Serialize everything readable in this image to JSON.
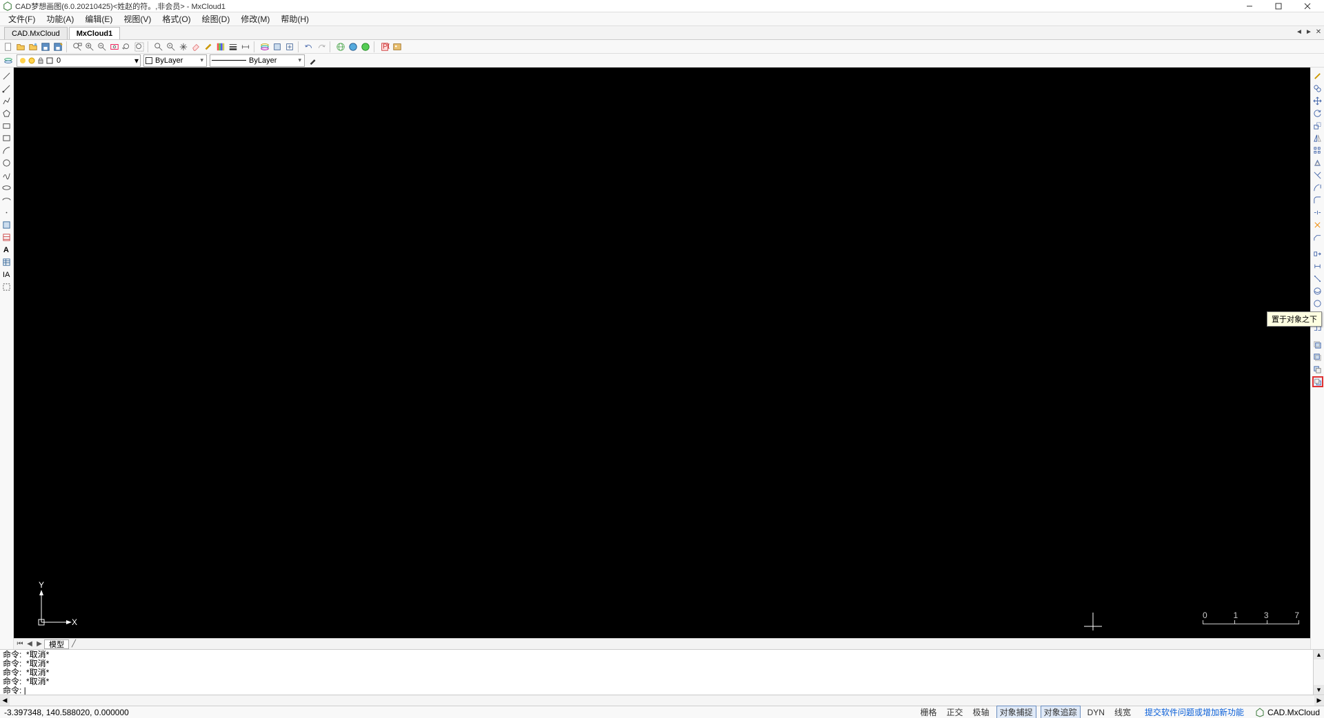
{
  "titlebar": {
    "title": "CAD梦想画图(6.0.20210425)<姓赵的符。,非会员> - MxCloud1"
  },
  "menu": {
    "file": "文件(F)",
    "func": "功能(A)",
    "edit": "编辑(E)",
    "view": "视图(V)",
    "format": "格式(O)",
    "draw": "绘图(D)",
    "modify": "修改(M)",
    "help": "帮助(H)"
  },
  "doctabs": {
    "tab1": "CAD.MxCloud",
    "tab2": "MxCloud1"
  },
  "propbar": {
    "layer_name": "0",
    "color": "ByLayer",
    "linetype": "ByLayer"
  },
  "canvas": {
    "ucs_y": "Y",
    "ucs_x": "X",
    "scale_ticks": [
      "0",
      "1",
      "3",
      "7"
    ]
  },
  "tooltip": {
    "text": "置于对象之下"
  },
  "modeltabs": {
    "model": "模型"
  },
  "cmd": {
    "l1": "命令:  *取消*",
    "l2": "命令:  *取消*",
    "l3": "命令:  *取消*",
    "l4": "命令:  *取消*",
    "prompt": "命令: |"
  },
  "status": {
    "coords": "-3.397348,  140.588020,  0.000000",
    "t_grid": "栅格",
    "t_ortho": "正交",
    "t_polar": "极轴",
    "t_osnap": "对象捕捉",
    "t_otrack": "对象追踪",
    "t_dyn": "DYN",
    "t_lwt": "线宽",
    "link": "提交软件问题或增加新功能",
    "brand": "CAD.MxCloud"
  }
}
